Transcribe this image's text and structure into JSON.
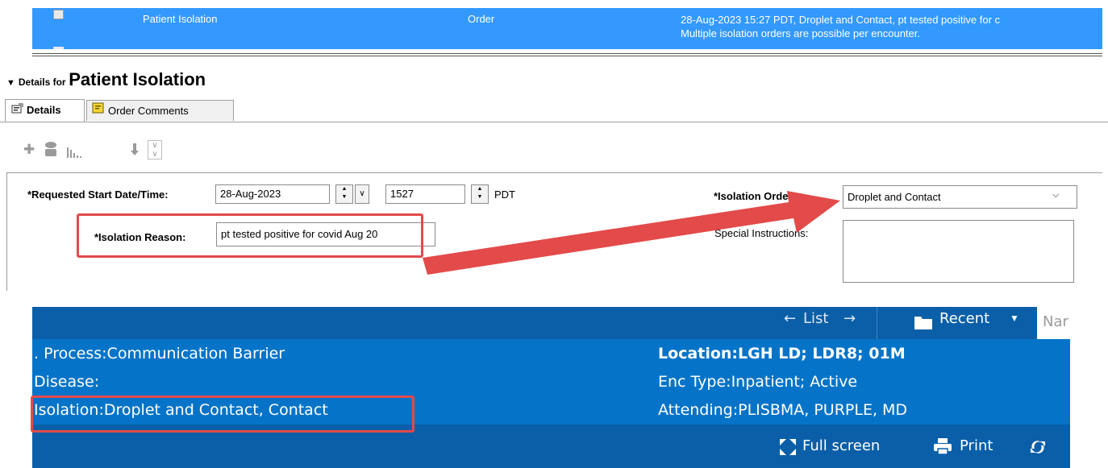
{
  "order_row": {
    "name": "Patient Isolation",
    "type": "Order",
    "details_line1": "28-Aug-2023 15:27 PDT, Droplet and Contact, pt tested positive for c",
    "details_line2": "Multiple isolation orders are possible per encounter."
  },
  "details_header": {
    "prefix": "Details for",
    "title": "Patient Isolation"
  },
  "tabs": [
    {
      "label": "Details",
      "active": true,
      "icon": "details-icon"
    },
    {
      "label": "Order Comments",
      "active": false,
      "icon": "comments-icon"
    }
  ],
  "form": {
    "start_label": "*Requested Start Date/Time:",
    "start_date": "28-Aug-2023",
    "start_time": "1527",
    "timezone": "PDT",
    "isolation_order_label": "*Isolation Orde",
    "isolation_order_value": "Droplet and Contact",
    "reason_label": "*Isolation Reason:",
    "reason_value": "pt tested positive for covid Aug 20",
    "special_label": "Special Instructions:",
    "special_value": ""
  },
  "banner": {
    "nav_list": "List",
    "recent": "Recent",
    "name_placeholder": "Nar",
    "process": ". Process:Communication Barrier",
    "disease": "Disease:",
    "isolation": "Isolation:Droplet and Contact, Contact",
    "location": "Location:LGH LD; LDR8; 01M",
    "enc_type": "Enc Type:Inpatient;  Active",
    "attending": "Attending:PLISBMA, PURPLE, MD",
    "full_screen": "Full screen",
    "print": "Print"
  },
  "colors": {
    "selected_row": "#3399ff",
    "banner": "#0574c8",
    "banner_dark": "#0a5fa8",
    "highlight": "#e34a4a"
  }
}
